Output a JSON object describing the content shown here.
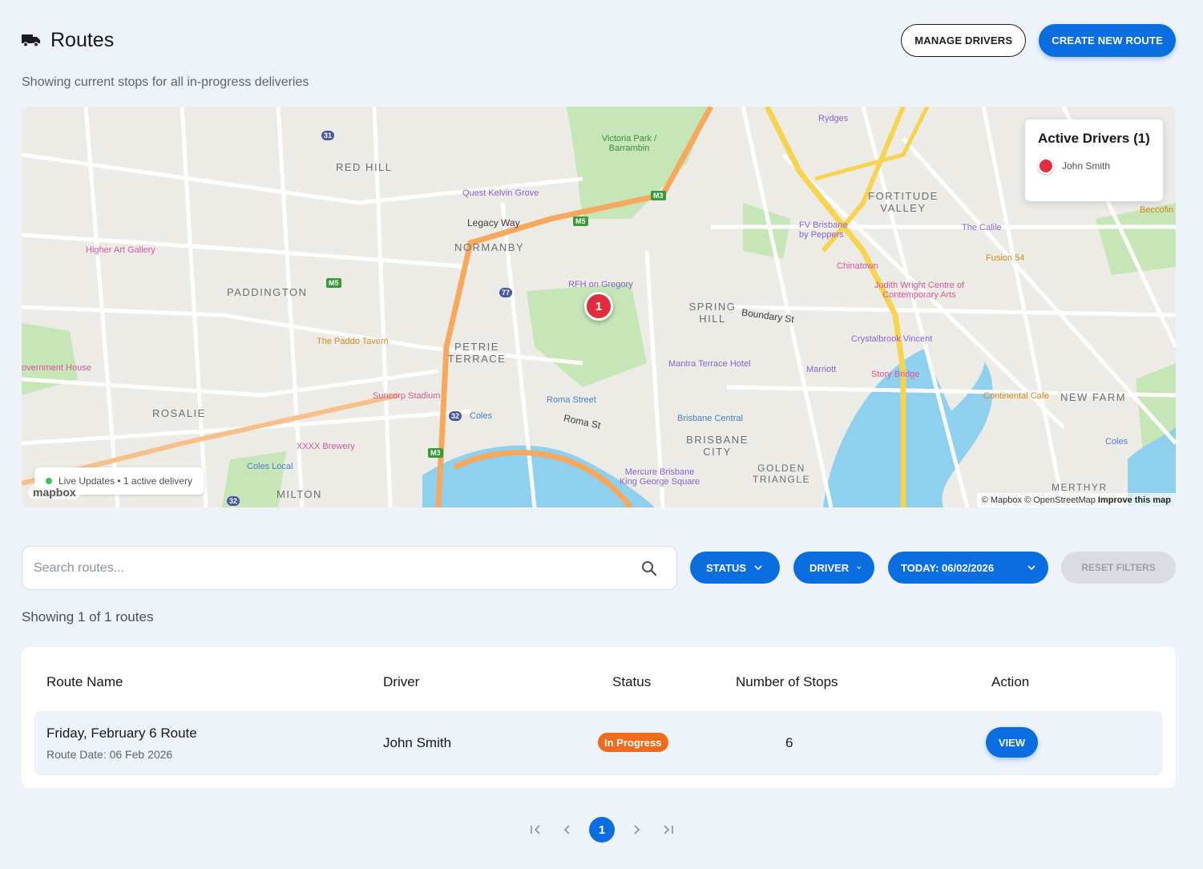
{
  "header": {
    "title": "Routes",
    "manage_label": "MANAGE DRIVERS",
    "create_label": "CREATE NEW ROUTE"
  },
  "subtitle": "Showing current stops for all in-progress deliveries",
  "map": {
    "marker_label": "1",
    "drivers_panel": {
      "title": "Active Drivers (1)",
      "drivers": [
        {
          "name": "John Smith",
          "color": "#e02c3c"
        }
      ]
    },
    "live_status": "Live Updates • 1 active delivery",
    "logo": "mapbox",
    "attribution": "© Mapbox © OpenStreetMap",
    "improve_link": "Improve this map",
    "labels": {
      "red_hill": "RED HILL",
      "paddington": "PADDINGTON",
      "normanby": "NORMANBY",
      "petrie_terrace": "PETRIE TERRACE",
      "spring_hill": "SPRING HILL",
      "fortitude_valley": "FORTITUDE VALLEY",
      "rosalie": "ROSALIE",
      "milton": "MILTON",
      "brisbane_city": "BRISBANE CITY",
      "golden_triangle": "GOLDEN TRIANGLE",
      "new_farm": "NEW FARM",
      "merthyr": "MERTHYR",
      "legacy_way": "Legacy Way",
      "boundary_st": "Boundary St",
      "roma_st": "Roma St",
      "victoria_park": "Victoria Park / Barrambin",
      "quest": "Quest Kelvin Grove",
      "rfh": "RFH on Gregory",
      "higher_art": "Higher Art Gallery",
      "paddo": "The Paddo Tavern",
      "suncorp": "Suncorp Stadium",
      "roma_street": "Roma Street",
      "coles": "Coles",
      "mantra": "Mantra Terrace Hotel",
      "brisbane_central": "Brisbane Central",
      "mercure": "Mercure Brisbane King George Square",
      "xxxx": "XXXX Brewery",
      "coles_local": "Coles Local",
      "government_house": "overnment House",
      "rydges": "Rydges",
      "fv_brisbane": "FV Brisbane by Peppers",
      "chinatown": "Chinatown",
      "judith": "Judith Wright Centre of Contemporary Arts",
      "crystalbrook": "Crystalbrook Vincent",
      "marriott": "Marriott",
      "story_bridge": "Story Bridge",
      "the_calile": "The Calile",
      "fusion": "Fusion 54",
      "continental": "Continental Cafe",
      "coles2": "Coles",
      "beccofino": "Beccofin"
    }
  },
  "search": {
    "placeholder": "Search routes..."
  },
  "filters": {
    "status": "STATUS",
    "driver": "DRIVER",
    "date": "TODAY: 06/02/2026",
    "reset": "RESET FILTERS"
  },
  "count_text": "Showing 1 of 1 routes",
  "table": {
    "headers": [
      "Route Name",
      "Driver",
      "Status",
      "Number of Stops",
      "Action"
    ],
    "rows": [
      {
        "name": "Friday, February 6 Route",
        "date": "Route Date: 06 Feb 2026",
        "driver": "John Smith",
        "status": "In Progress",
        "stops": "6",
        "action": "VIEW"
      }
    ]
  },
  "pagination": {
    "current": "1",
    "first": "|‹",
    "prev": "‹",
    "next": "›",
    "last": "›|"
  },
  "colors": {
    "primary": "#0a6de0",
    "status_in_progress": "#f26b1d",
    "driver_marker": "#e02c3c"
  }
}
